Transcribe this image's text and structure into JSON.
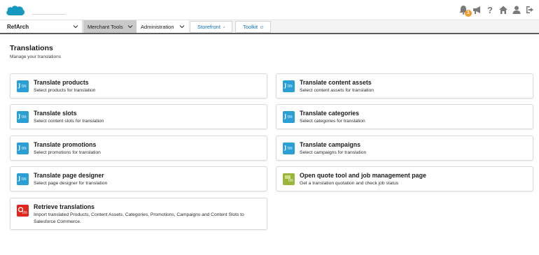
{
  "header": {
    "logo_icon": "salesforce-cloud-icon",
    "notification_count": "1",
    "icons": [
      "bell-icon",
      "megaphone-icon",
      "help-icon",
      "home-icon",
      "user-icon",
      "logout-icon"
    ]
  },
  "nav": {
    "site": "RefArch",
    "merchant_tools": "Merchant Tools",
    "administration": "Administration",
    "storefront": "Storefront",
    "toolkit": "Toolkit"
  },
  "page": {
    "title": "Translations",
    "subtitle": "Manage your translations"
  },
  "cards": [
    {
      "title": "Translate products",
      "description": "Select products for translation",
      "icon": "translate-icon",
      "color": "#2a9fd6"
    },
    {
      "title": "Translate content assets",
      "description": "Select content assets for translation",
      "icon": "translate-icon",
      "color": "#2a9fd6"
    },
    {
      "title": "Translate slots",
      "description": "Select content slots for translation",
      "icon": "translate-icon",
      "color": "#2a9fd6"
    },
    {
      "title": "Translate categories",
      "description": "Select categories for translation",
      "icon": "translate-icon",
      "color": "#2a9fd6"
    },
    {
      "title": "Translate promotions",
      "description": "Select promotions for translation",
      "icon": "translate-icon",
      "color": "#2a9fd6"
    },
    {
      "title": "Translate campaigns",
      "description": "Select campaigns for translation",
      "icon": "translate-icon",
      "color": "#2a9fd6"
    },
    {
      "title": "Translate page designer",
      "description": "Select page designer for translation",
      "icon": "translate-icon",
      "color": "#2a9fd6"
    },
    {
      "title": "Open quote tool and job management page",
      "description": "Get a translation quotation and check job status",
      "icon": "quote-tool-icon",
      "color": "#9ab53a"
    },
    {
      "title": "Retrieve translations",
      "description": "Import translated Products, Content Assets, Categories, Promotions, Campaigns and Content Slots to Salesforce Commerce.",
      "icon": "retrieve-icon",
      "color": "#e0261d"
    }
  ],
  "colors": {
    "link": "#0b6fb5",
    "nav_active": "#c9c9c9",
    "badge": "#f39b2d",
    "logo": "#1798c1"
  }
}
